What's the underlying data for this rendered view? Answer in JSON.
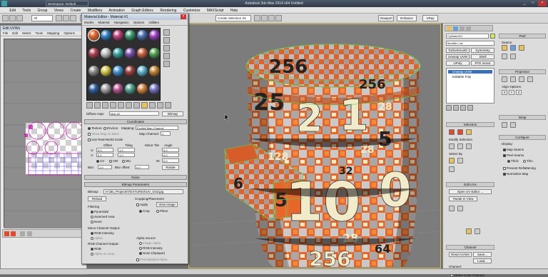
{
  "app": {
    "window_title": "Autodesk 3ds Max  2014 x64     Untitled",
    "workspace": "Workspace: Default"
  },
  "menu": [
    "Edit",
    "Tools",
    "Group",
    "Views",
    "Create",
    "Modifiers",
    "Animation",
    "Graph Editors",
    "Rendering",
    "Customize",
    "MAXScript",
    "Help"
  ],
  "toolbar": {
    "filter": "All",
    "selection_set": "Create Selection Se",
    "view_right": "Viewport",
    "nitrous": "Nitrous",
    "enhance": "Enhance",
    "vray": "VRay"
  },
  "uvw": {
    "title": "Edit UVWs",
    "menu": [
      "File",
      "Edit",
      "Select",
      "Tools",
      "Mapping",
      "Options"
    ]
  },
  "mat": {
    "title": "Material Editor - Material #1",
    "menu": [
      "Modes",
      "Material",
      "Navigation",
      "Options",
      "Utilities"
    ],
    "map_label": "Diffuse map:",
    "map_name": "Map #2",
    "map_type": "Bitmap",
    "coord_title": "Coordinates",
    "texture": "Texture",
    "environ": "Environ",
    "mapping": "Mapping:",
    "mapping_value": "Explicit Map Channel",
    "map_channel": "Map Channel:",
    "map_channel_value": "1",
    "show_map": "Show Map on Back",
    "real_world": "Use Real-World Scale",
    "offset": "Offset",
    "tiling": "Tiling",
    "mirror_tile": "Mirror Tile",
    "angle": "Angle",
    "u": "U:",
    "v": "V:",
    "w": "W:",
    "uv": "UV",
    "vw": "VW",
    "wu": "WU",
    "offset_u": "0.0",
    "offset_v": "0.0",
    "tiling_u": "1.0",
    "tiling_v": "1.0",
    "angle_u": "0.0",
    "angle_v": "0.0",
    "angle_w": "0.0",
    "blur": "Blur:",
    "blur_value": "1.0",
    "blur_offset": "Blur offset:",
    "blur_offset_value": "0.0",
    "rotate": "Rotate",
    "noise": "Noise",
    "bitmap_params": "Bitmap Parameters",
    "bitmap_label": "Bitmap:",
    "bitmap_path": "H:\\3D_Projects\\TEXTURES\\UV_Grid.jpg",
    "reload": "Reload",
    "cropping": "Cropping/Placement",
    "apply": "Apply",
    "view_image": "View Image",
    "crop": "Crop",
    "place": "Place",
    "filtering": "Filtering",
    "pyramidal": "Pyramidal",
    "summed": "Summed Area",
    "none": "None",
    "mono": "Mono Channel Output:",
    "rgb_intensity": "RGB Intensity",
    "alpha": "Alpha",
    "rgb_out": "RGB Channel Output:",
    "rgb": "RGB",
    "alpha_gray": "Alpha as Gray",
    "alpha_source": "Alpha Source",
    "image_alpha": "Image Alpha",
    "rgb_int2": "RGB Intensity",
    "none_opaque": "None (Opaque)",
    "premult": "Premultiplied Alpha"
  },
  "viewport": {
    "label": "[+][Perspective][Realistic]",
    "texture_numbers": [
      "256",
      "256",
      "25",
      "2",
      "1",
      "5",
      "10",
      "128",
      "28",
      "32",
      "28",
      "28",
      "256",
      "64",
      "0",
      "6",
      "5"
    ]
  },
  "right": {
    "object_name": "Cylinder001",
    "modifier_list": "Modifier List",
    "mods": [
      "TurboSmooth",
      "Symmetry",
      "Unwrap UVW",
      "Shell",
      "UPoly",
      "FFD 4x4x4"
    ],
    "stack": [
      "Unwrap UVW",
      "Editable Poly"
    ],
    "peel": "Peel",
    "seams": "Seams:",
    "projection": "Projection",
    "align_options": "Align Options:",
    "wrap": "Wrap",
    "configure": "Configure",
    "display": "Display:",
    "map_seams": "Map Seams",
    "peel_seams": "Peel Seams",
    "thick": "Thick",
    "thin": "Thin",
    "prevent": "Prevent Reflattening",
    "normalize": "Normalize Map",
    "selection": "Selection",
    "modify_sel": "Modify Selection",
    "select_by": "Select By",
    "edit_uvs": "Edit UVs",
    "open_uv": "Open UV Editor ...",
    "tweak": "Tweak In View",
    "channel": "Channel",
    "reset": "Reset UVWs",
    "save": "Save...",
    "load": "Load...",
    "channel2": "Channel:",
    "map_channel": "Map Channel:",
    "map_channel_value": "1",
    "vertex_color": "Vertex Color Channel"
  },
  "colors": {
    "orange": "#e8662a",
    "cream": "#f1ebc9",
    "grey": "#9a9a9a",
    "dark": "#222222",
    "select": "#5ec94a"
  }
}
